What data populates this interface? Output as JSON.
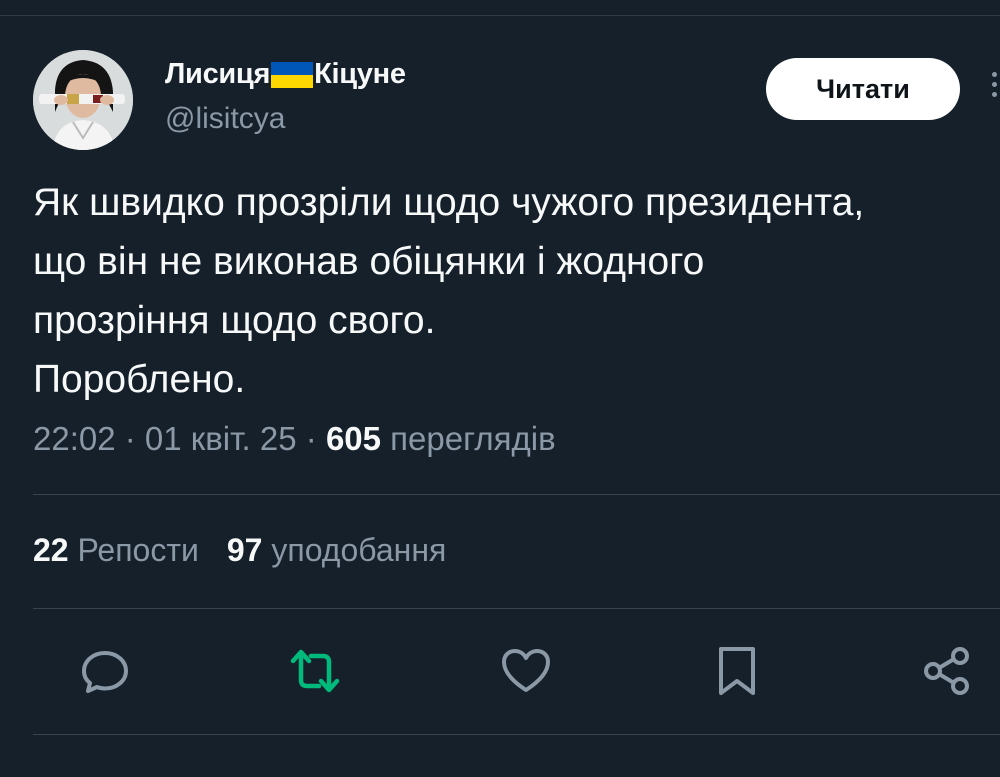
{
  "tweet": {
    "author": {
      "name_prefix": "Лисиця",
      "name_suffix": "Кіцуне",
      "flag_icon": "ukraine-flag-icon",
      "handle": "@lisitcya"
    },
    "follow_label": "Читати",
    "text_lines": [
      "Як швидко прозріли щодо чужого президента,",
      "що він не виконав обіцянки і жодного",
      "прозріння щодо свого.",
      "Пороблено."
    ],
    "time": "22:02",
    "date": "01 квіт. 25",
    "separator": " · ",
    "views_count": "605",
    "views_label": "переглядів",
    "reposts_count": "22",
    "reposts_label": "Репости",
    "likes_count": "97",
    "likes_label": "уподобання"
  },
  "actions": [
    "reply-icon",
    "repost-icon",
    "like-icon",
    "bookmark-icon",
    "share-icon"
  ],
  "colors": {
    "background": "#15202b",
    "text": "#f7f9f9",
    "muted": "#8b98a5",
    "repost_green": "#00ba7c",
    "divider": "#38444d",
    "flag_blue": "#0057b7",
    "flag_yellow": "#ffd700"
  }
}
